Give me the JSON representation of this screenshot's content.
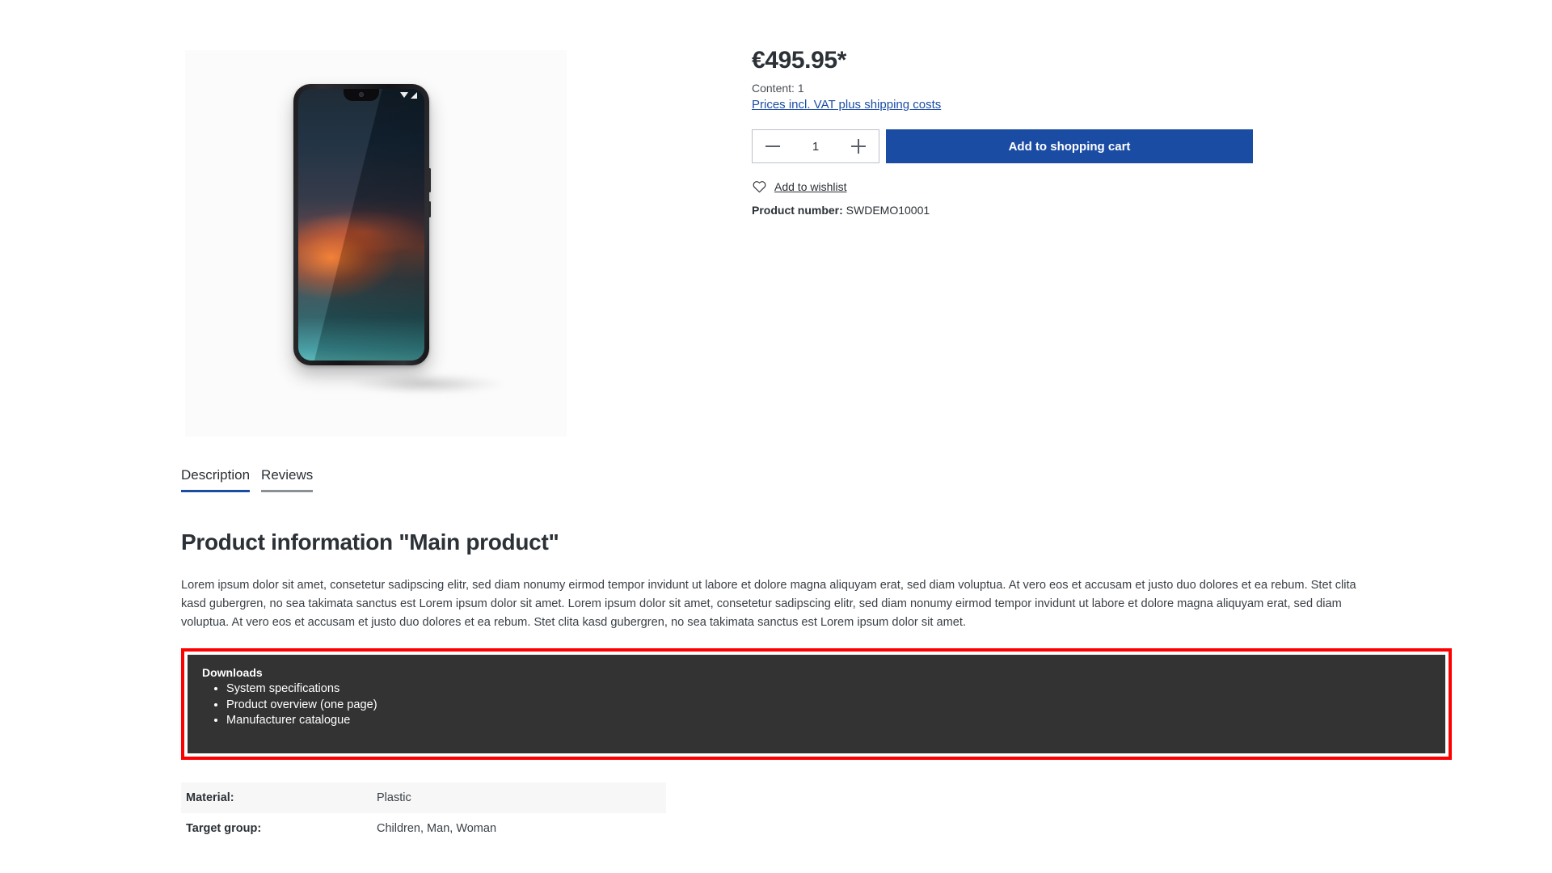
{
  "product": {
    "price": "€495.95*",
    "content_line": "Content: 1",
    "vat_link": "Prices incl. VAT plus shipping costs",
    "quantity": "1",
    "add_to_cart_label": "Add to shopping cart",
    "wishlist_label": "Add to wishlist",
    "product_number_label": "Product number:",
    "product_number_value": "SWDEMO10001",
    "image_alt": "smartphone-product-image"
  },
  "tabs": [
    {
      "label": "Description",
      "state": "active"
    },
    {
      "label": "Reviews",
      "state": "inactive"
    }
  ],
  "description": {
    "heading": "Product information \"Main product\"",
    "paragraph": "Lorem ipsum dolor sit amet, consetetur sadipscing elitr, sed diam nonumy eirmod tempor invidunt ut labore et dolore magna aliquyam erat, sed diam voluptua. At vero eos et accusam et justo duo dolores et ea rebum. Stet clita kasd gubergren, no sea takimata sanctus est Lorem ipsum dolor sit amet. Lorem ipsum dolor sit amet, consetetur sadipscing elitr, sed diam nonumy eirmod tempor invidunt ut labore et dolore magna aliquyam erat, sed diam voluptua. At vero eos et accusam et justo duo dolores et ea rebum. Stet clita kasd gubergren, no sea takimata sanctus est Lorem ipsum dolor sit amet."
  },
  "downloads": {
    "title": "Downloads",
    "items": [
      "System specifications",
      "Product overview (one page)",
      "Manufacturer catalogue"
    ]
  },
  "properties": {
    "rows": [
      {
        "label": "Material:",
        "value": "Plastic"
      },
      {
        "label": "Target group:",
        "value": "Children, Man, Woman"
      }
    ]
  },
  "colors": {
    "accent_blue": "#1b4ca3",
    "highlight_red": "#ff0000",
    "panel_dark": "#333333",
    "text": "#2b3136"
  },
  "icons": {
    "heart": "heart-icon",
    "minus": "minus-icon",
    "plus": "plus-icon"
  }
}
